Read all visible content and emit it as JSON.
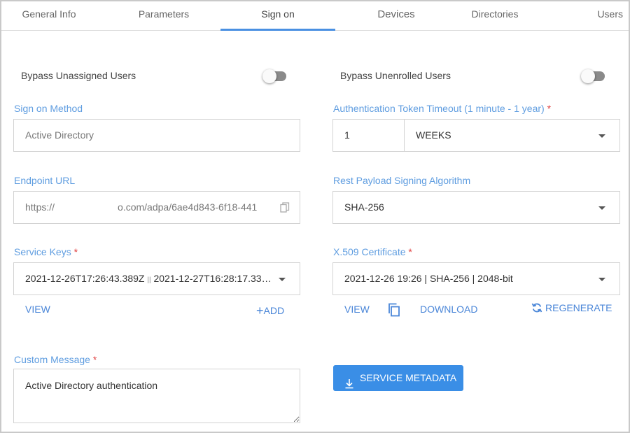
{
  "tabs": [
    {
      "label": "General Info"
    },
    {
      "label": "Parameters"
    },
    {
      "label": "Sign on"
    },
    {
      "label": "Devices"
    },
    {
      "label": "Directories"
    },
    {
      "label": "Users"
    }
  ],
  "active_tab": "Sign on",
  "bypass_unassigned": {
    "label": "Bypass Unassigned Users",
    "enabled": false
  },
  "bypass_unenrolled": {
    "label": "Bypass Unenrolled Users",
    "enabled": false
  },
  "sign_on_method": {
    "label": "Sign on Method",
    "value": "Active Directory"
  },
  "auth_token_timeout": {
    "label": "Authentication Token Timeout (1 minute - 1 year)",
    "required_mark": "*",
    "amount": "1",
    "unit": "WEEKS"
  },
  "endpoint_url": {
    "label": "Endpoint URL",
    "value_prefix": "https://",
    "value_suffix": "o.com/adpa/6ae4d843-6f18-441"
  },
  "rest_signing": {
    "label": "Rest Payload Signing Algorithm",
    "value": "SHA-256"
  },
  "service_keys": {
    "label": "Service Keys",
    "required_mark": "*",
    "value_start": "2021-12-26T17:26:43.389Z",
    "separator": "||",
    "value_end": "2021-12-27T16:28:17.33…",
    "view_label": "VIEW",
    "add_label": "ADD",
    "add_icon": "+"
  },
  "x509": {
    "label": "X.509 Certificate",
    "required_mark": "*",
    "value": "2021-12-26 19:26 | SHA-256 | 2048-bit",
    "view_label": "VIEW",
    "download_label": "DOWNLOAD",
    "regenerate_label": "REGENERATE"
  },
  "custom_message": {
    "label": "Custom Message",
    "required_mark": "*",
    "value": "Active Directory authentication"
  },
  "service_metadata_label": "SERVICE METADATA",
  "colors": {
    "accent": "#4a90e2",
    "label": "#5f9de0",
    "button": "#3a8ee6",
    "required": "#e04040"
  }
}
